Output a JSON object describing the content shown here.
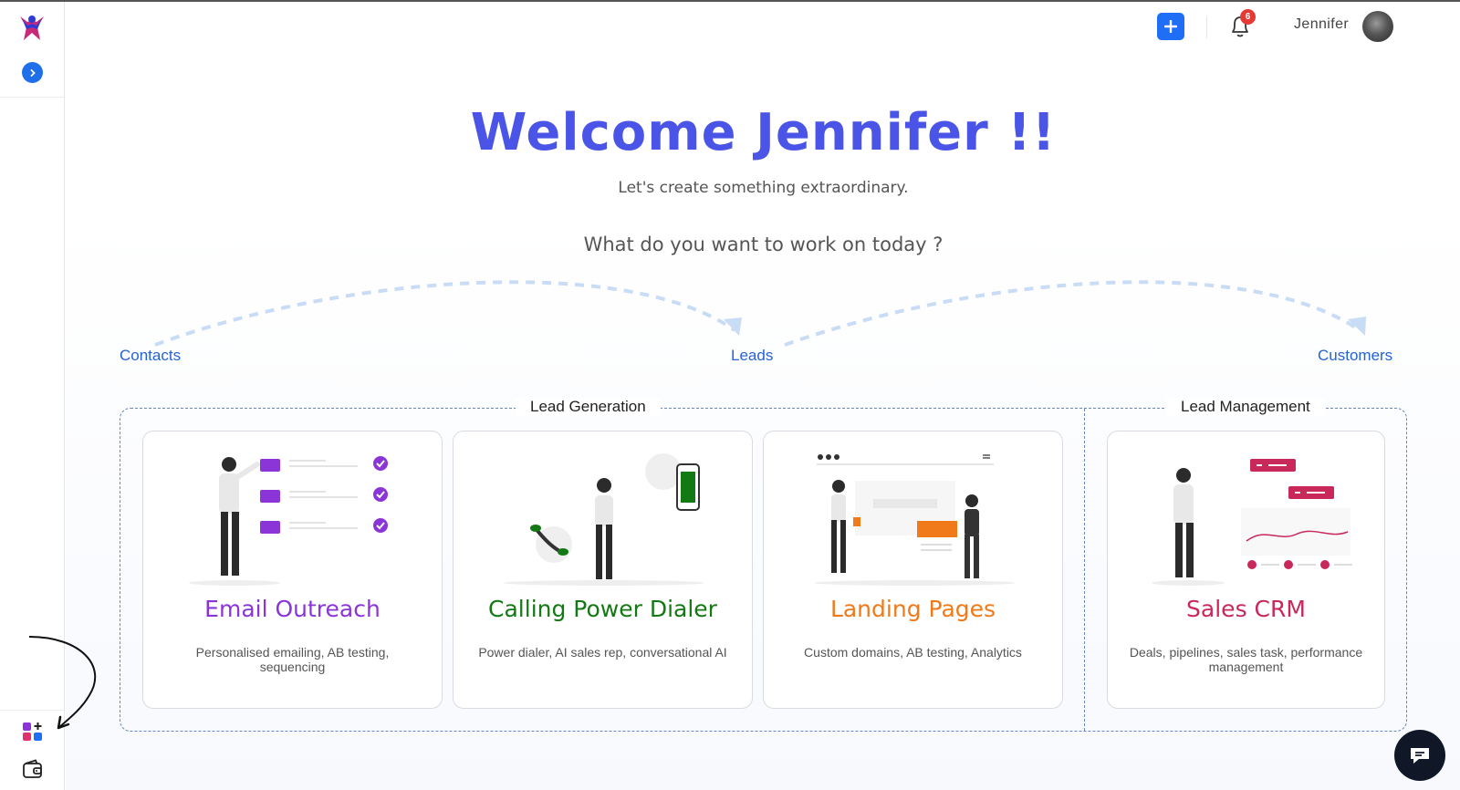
{
  "header": {
    "user_name": "Jennifer",
    "notification_count": "6",
    "add_icon": "plus-icon",
    "bell_icon": "bell-icon"
  },
  "sidebar": {
    "expand_icon": "chevron-right-icon",
    "bottom_items": [
      "apps-add-icon",
      "wallet-icon"
    ]
  },
  "main": {
    "welcome": "Welcome Jennifer !!",
    "subtitle": "Let's create something extraordinary.",
    "question": "What do you want to work on today ?",
    "stages": [
      "Contacts",
      "Leads",
      "Customers"
    ],
    "sections": {
      "lead_generation": "Lead Generation",
      "lead_management": "Lead Management"
    },
    "cards": [
      {
        "title": "Email Outreach",
        "desc": "Personalised emailing, AB testing, sequencing",
        "color": "#8b35d8"
      },
      {
        "title": "Calling Power Dialer",
        "desc": "Power dialer, AI sales rep, conversational AI",
        "color": "#137a13"
      },
      {
        "title": "Landing Pages",
        "desc": "Custom domains, AB testing, Analytics",
        "color": "#f07a1a"
      },
      {
        "title": "Sales CRM",
        "desc": "Deals, pipelines, sales task, performance management",
        "color": "#c8285a"
      }
    ]
  },
  "colors": {
    "welcome": "#4a55e8",
    "stage": "#2563d6",
    "primary_button": "#1e6ff5"
  },
  "chat_icon": "chat-bubble-icon"
}
